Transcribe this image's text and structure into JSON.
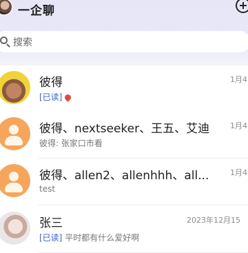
{
  "header": {
    "title": "一企聊",
    "avatar_icon": "user-avatar",
    "add_icon": "add-circle-icon"
  },
  "search": {
    "placeholder": "搜索"
  },
  "chats": [
    {
      "name": "彼得",
      "time": "1月4",
      "read_status": "[已读]",
      "preview": "",
      "avatar": "photo",
      "emoji_icon": "red-emoji-icon"
    },
    {
      "name": "彼得、nextseeker、王五、艾迪",
      "time": "1月4",
      "read_status": "",
      "preview": "彼得: 张家口市看",
      "avatar": "default"
    },
    {
      "name": "彼得、allen2、allenhhh、all...",
      "time": "1月4",
      "read_status": "",
      "preview": "test",
      "avatar": "default"
    },
    {
      "name": "张三",
      "time": "2023年12月15",
      "read_status": "[已读]",
      "preview": "平时都有什么爱好啊",
      "avatar": "photo"
    }
  ]
}
